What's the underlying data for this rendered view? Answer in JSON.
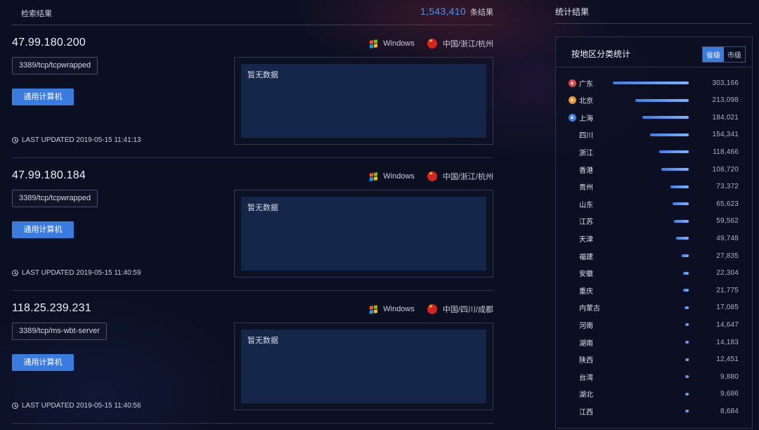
{
  "results": {
    "title": "检索结果",
    "total": "1,543,410",
    "total_unit": "条结果",
    "cards": [
      {
        "ip": "47.99.180.200",
        "os": "Windows",
        "location": "中国/浙江/杭州",
        "port": "3389/tcp/tcpwrapped",
        "tag": "通用计算机",
        "updated": "LAST UPDATED 2019-05-15 11:41:13",
        "detail": "暂无数据"
      },
      {
        "ip": "47.99.180.184",
        "os": "Windows",
        "location": "中国/浙江/杭州",
        "port": "3389/tcp/tcpwrapped",
        "tag": "通用计算机",
        "updated": "LAST UPDATED 2019-05-15 11:40:59",
        "detail": "暂无数据"
      },
      {
        "ip": "118.25.239.231",
        "os": "Windows",
        "location": "中国/四川/成都",
        "port": "3389/tcp/ms-wbt-server",
        "tag": "通用计算机",
        "updated": "LAST UPDATED 2019-05-15 11:40:56",
        "detail": "暂无数据"
      }
    ]
  },
  "stats": {
    "title": "统计结果",
    "panel_title": "按地区分类统计",
    "toggle": [
      "省级",
      "市级"
    ],
    "toggle_active": 0,
    "rank_colors": [
      "#e4463c",
      "#f0932b",
      "#3d7fe6"
    ],
    "max": 303166,
    "rows": [
      {
        "region": "广东",
        "value": 303166,
        "label": "303,166"
      },
      {
        "region": "北京",
        "value": 213098,
        "label": "213,098"
      },
      {
        "region": "上海",
        "value": 184021,
        "label": "184,021"
      },
      {
        "region": "四川",
        "value": 154341,
        "label": "154,341"
      },
      {
        "region": "浙江",
        "value": 118466,
        "label": "118,466"
      },
      {
        "region": "香港",
        "value": 108720,
        "label": "108,720"
      },
      {
        "region": "贵州",
        "value": 73372,
        "label": "73,372"
      },
      {
        "region": "山东",
        "value": 65623,
        "label": "65,623"
      },
      {
        "region": "江苏",
        "value": 59562,
        "label": "59,562"
      },
      {
        "region": "天津",
        "value": 49748,
        "label": "49,748"
      },
      {
        "region": "福建",
        "value": 27835,
        "label": "27,835"
      },
      {
        "region": "安徽",
        "value": 22304,
        "label": "22,304"
      },
      {
        "region": "重庆",
        "value": 21775,
        "label": "21,775"
      },
      {
        "region": "内蒙古",
        "value": 17085,
        "label": "17,085"
      },
      {
        "region": "河南",
        "value": 14647,
        "label": "14,647"
      },
      {
        "region": "湖南",
        "value": 14183,
        "label": "14,183"
      },
      {
        "region": "陕西",
        "value": 12451,
        "label": "12,451"
      },
      {
        "region": "台湾",
        "value": 9880,
        "label": "9,880"
      },
      {
        "region": "湖北",
        "value": 9686,
        "label": "9,686"
      },
      {
        "region": "江西",
        "value": 8684,
        "label": "8,684"
      }
    ]
  },
  "icons": {
    "os": "windows-icon",
    "flag": "china-flag-icon",
    "clock": "clock-icon",
    "rank": "rank-badge-icon"
  },
  "colors": {
    "accent": "#3a7be0",
    "count_number": "#4f8fe6",
    "background": "#0b0f22",
    "detail_box": "#142649"
  }
}
